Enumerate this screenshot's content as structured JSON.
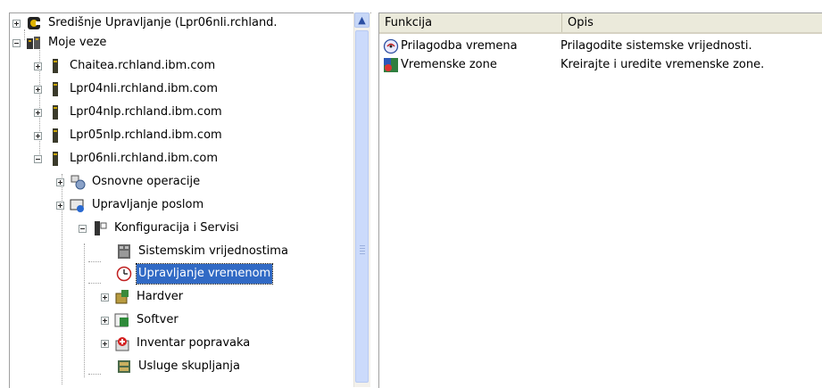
{
  "tree": {
    "items": [
      {
        "label": "Središnje Upravljanje (Lpr06nli.rchland.",
        "icon": "central-management-icon"
      },
      {
        "label": "Moje veze",
        "icon": "connections-folder-icon"
      },
      {
        "label": "Chaitea.rchland.ibm.com",
        "icon": "server-icon"
      },
      {
        "label": "Lpr04nli.rchland.ibm.com",
        "icon": "server-icon"
      },
      {
        "label": "Lpr04nlp.rchland.ibm.com",
        "icon": "server-icon"
      },
      {
        "label": "Lpr05nlp.rchland.ibm.com",
        "icon": "server-icon"
      },
      {
        "label": "Lpr06nli.rchland.ibm.com",
        "icon": "server-icon"
      },
      {
        "label": "Osnovne operacije",
        "icon": "basic-operations-icon"
      },
      {
        "label": "Upravljanje poslom",
        "icon": "work-management-icon"
      },
      {
        "label": "Konfiguracija i Servisi",
        "icon": "configuration-icon"
      },
      {
        "label": "Sistemskim vrijednostima",
        "icon": "system-values-icon"
      },
      {
        "label": "Upravljanje vremenom",
        "icon": "clock-icon"
      },
      {
        "label": "Hardver",
        "icon": "hardware-icon"
      },
      {
        "label": "Softver",
        "icon": "software-icon"
      },
      {
        "label": "Inventar popravaka",
        "icon": "fix-inventory-icon"
      },
      {
        "label": "Usluge skupljanja",
        "icon": "collection-services-icon"
      }
    ],
    "selected_index": 11
  },
  "list": {
    "columns": [
      "Funkcija",
      "Opis"
    ],
    "rows": [
      {
        "function": "Prilagodba vremena",
        "description": "Prilagodite sistemske vrijednosti.",
        "icon": "time-adjustment-icon"
      },
      {
        "function": "Vremenske zone",
        "description": "Kreirajte i uredite vremenske zone.",
        "icon": "time-zones-icon"
      }
    ]
  },
  "colors": {
    "selection": "#316ac5",
    "header_bg": "#ebeadb",
    "scrollbar": "#cbdafb"
  }
}
